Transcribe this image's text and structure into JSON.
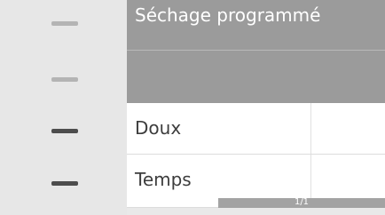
{
  "header": {
    "title": "Séchage programmé"
  },
  "menu": {
    "items": [
      {
        "label": "Doux"
      },
      {
        "label": "Temps"
      }
    ]
  },
  "pagination": {
    "text": "1/1"
  },
  "rail": {
    "markers": [
      {
        "state": "inactive",
        "icon": "dash-icon"
      },
      {
        "state": "inactive",
        "icon": "dash-icon"
      },
      {
        "state": "active",
        "icon": "dash-icon"
      },
      {
        "state": "active",
        "icon": "dash-icon"
      }
    ]
  }
}
